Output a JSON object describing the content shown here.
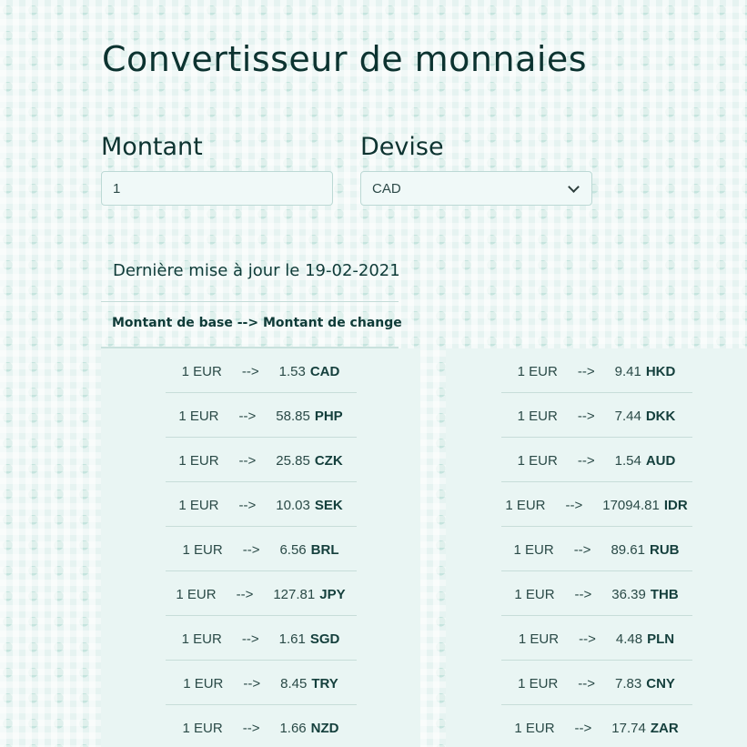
{
  "app": {
    "title": "Convertisseur de monnaies"
  },
  "form": {
    "amount_label": "Montant",
    "amount_value": "1",
    "currency_label": "Devise",
    "currency_selected": "CAD"
  },
  "info": {
    "last_update": "Dernière mise à jour le 19-02-2021",
    "table_heading": "Montant de base --> Montant de change"
  },
  "rates_left": [
    {
      "base": "1 EUR",
      "arrow": "-->",
      "value": "1.53",
      "code": "CAD"
    },
    {
      "base": "1 EUR",
      "arrow": "-->",
      "value": "58.85",
      "code": "PHP"
    },
    {
      "base": "1 EUR",
      "arrow": "-->",
      "value": "25.85",
      "code": "CZK"
    },
    {
      "base": "1 EUR",
      "arrow": "-->",
      "value": "10.03",
      "code": "SEK"
    },
    {
      "base": "1 EUR",
      "arrow": "-->",
      "value": "6.56",
      "code": "BRL"
    },
    {
      "base": "1 EUR",
      "arrow": "-->",
      "value": "127.81",
      "code": "JPY"
    },
    {
      "base": "1 EUR",
      "arrow": "-->",
      "value": "1.61",
      "code": "SGD"
    },
    {
      "base": "1 EUR",
      "arrow": "-->",
      "value": "8.45",
      "code": "TRY"
    },
    {
      "base": "1 EUR",
      "arrow": "-->",
      "value": "1.66",
      "code": "NZD"
    }
  ],
  "rates_right": [
    {
      "base": "1 EUR",
      "arrow": "-->",
      "value": "9.41",
      "code": "HKD"
    },
    {
      "base": "1 EUR",
      "arrow": "-->",
      "value": "7.44",
      "code": "DKK"
    },
    {
      "base": "1 EUR",
      "arrow": "-->",
      "value": "1.54",
      "code": "AUD"
    },
    {
      "base": "1 EUR",
      "arrow": "-->",
      "value": "17094.81",
      "code": "IDR"
    },
    {
      "base": "1 EUR",
      "arrow": "-->",
      "value": "89.61",
      "code": "RUB"
    },
    {
      "base": "1 EUR",
      "arrow": "-->",
      "value": "36.39",
      "code": "THB"
    },
    {
      "base": "1 EUR",
      "arrow": "-->",
      "value": "4.48",
      "code": "PLN"
    },
    {
      "base": "1 EUR",
      "arrow": "-->",
      "value": "7.83",
      "code": "CNY"
    },
    {
      "base": "1 EUR",
      "arrow": "-->",
      "value": "17.74",
      "code": "ZAR"
    }
  ]
}
